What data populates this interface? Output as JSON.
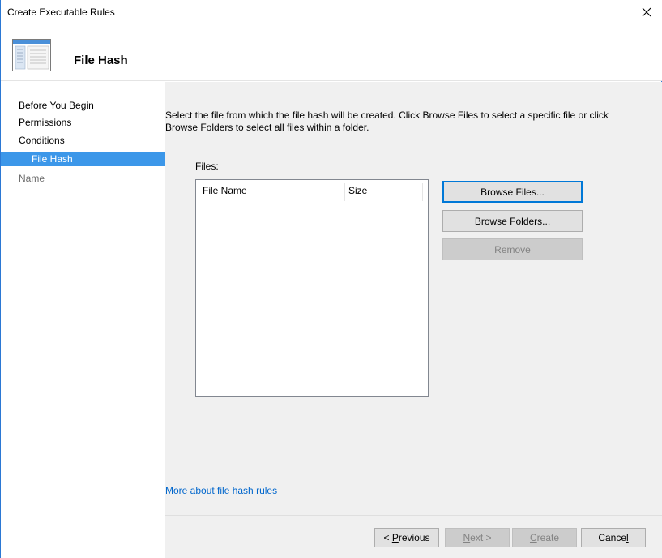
{
  "window": {
    "title": "Create Executable Rules"
  },
  "header": {
    "title": "File Hash",
    "icon": "wizard-page-icon"
  },
  "sidebar": {
    "items": [
      {
        "label": "Before You Begin",
        "state": "normal"
      },
      {
        "label": "Permissions",
        "state": "normal"
      },
      {
        "label": "Conditions",
        "state": "normal"
      },
      {
        "label": "File Hash",
        "state": "active"
      },
      {
        "label": "Name",
        "state": "disabled"
      }
    ]
  },
  "main": {
    "instructions_line1": "Select the file from which the file hash will be created. Click Browse Files to select a specific file or click",
    "instructions_line2": "Browse Folders to select all files within a folder.",
    "files_label": "Files:",
    "columns": [
      "File Name",
      "Size"
    ],
    "rows": [],
    "browse_files_label": "Browse Files...",
    "browse_folders_label": "Browse Folders...",
    "remove_label": "Remove",
    "more_link": "More about file hash rules"
  },
  "footer": {
    "previous_pre": "< ",
    "previous_key": "P",
    "previous_post": "revious",
    "next_key": "N",
    "next_post": "ext >",
    "create_key": "C",
    "create_post": "reate",
    "cancel_pre": "Cance",
    "cancel_key": "l"
  },
  "colors": {
    "accent": "#3c97e9",
    "window_border": "#2b78d4",
    "link": "#0066cc",
    "panel_bg": "#f0f0f0"
  }
}
